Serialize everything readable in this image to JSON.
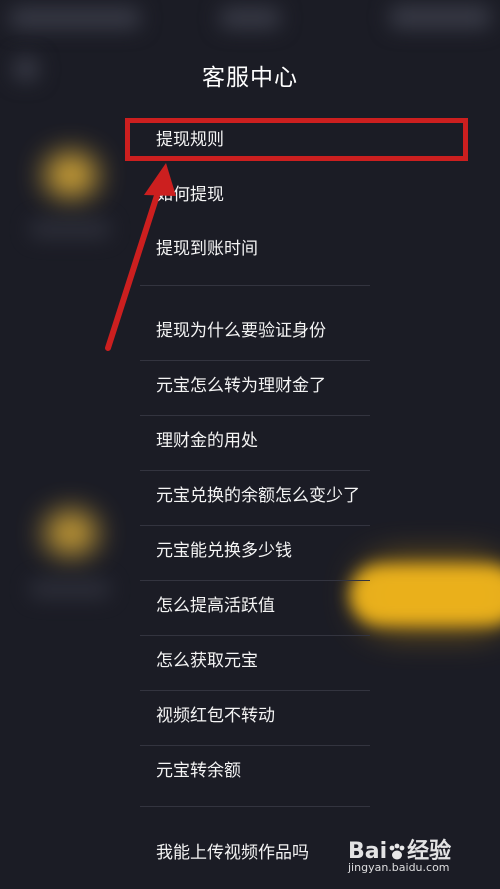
{
  "header": {
    "title": "客服中心"
  },
  "menu": {
    "items": [
      {
        "label": "提现规则"
      },
      {
        "label": "如何提现"
      },
      {
        "label": "提现到账时间"
      },
      {
        "label": "提现为什么要验证身份"
      },
      {
        "label": "元宝怎么转为理财金了"
      },
      {
        "label": "理财金的用处"
      },
      {
        "label": "元宝兑换的余额怎么变少了"
      },
      {
        "label": "元宝能兑换多少钱"
      },
      {
        "label": "怎么提高活跃值"
      },
      {
        "label": "怎么获取元宝"
      },
      {
        "label": "视频红包不转动"
      },
      {
        "label": "元宝转余额"
      },
      {
        "label": "我能上传视频作品吗"
      }
    ]
  },
  "annotation": {
    "color": "#cc1f1f",
    "highlighted_item": "提现规则"
  },
  "watermark": {
    "brand_prefix": "Bai",
    "brand_suffix": "经验",
    "url": "jingyan.baidu.com"
  },
  "colors": {
    "background": "#1b1c25",
    "text": "#f4f4f4",
    "accent_blur": "#f0b51c"
  }
}
